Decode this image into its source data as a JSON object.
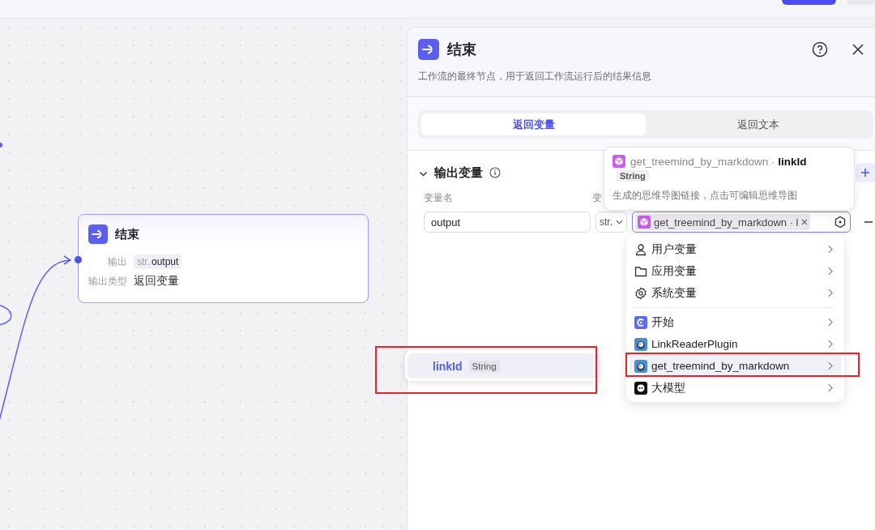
{
  "canvas": {
    "node": {
      "title": "结束",
      "rows": [
        {
          "kind": "tag",
          "label": "输出",
          "type_tag": "str.",
          "value": "output"
        },
        {
          "kind": "text",
          "label": "输出类型",
          "value": "返回变量"
        }
      ]
    }
  },
  "panel": {
    "title": "结束",
    "description": "工作流的最终节点，用于返回工作流运行后的结果信息",
    "tabs": [
      {
        "label": "返回变量",
        "selected": true
      },
      {
        "label": "返回文本",
        "selected": false
      }
    ],
    "section": {
      "title": "输出变量",
      "expanded": true,
      "columns": [
        {
          "label": "变量名"
        },
        {
          "label": "变"
        }
      ],
      "rows": [
        {
          "name": "output",
          "type": "str.",
          "reference": "get_treemind_by_markdown · l"
        }
      ]
    }
  },
  "tooltip": {
    "source": "get_treemind_by_markdown · ",
    "field": "linkId",
    "type": "String",
    "description": "生成的思维导图链接，点击可编辑思维导图"
  },
  "menu": {
    "groups": [
      [
        {
          "kind": "user",
          "label": "用户变量",
          "selected": false
        },
        {
          "kind": "folder",
          "label": "应用变量",
          "selected": false
        },
        {
          "kind": "system",
          "label": "系统变量",
          "selected": false
        }
      ],
      [
        {
          "kind": "start",
          "label": "开始",
          "selected": false
        },
        {
          "kind": "plugin",
          "label": "LinkReaderPlugin",
          "selected": false
        },
        {
          "kind": "plugin",
          "label": "get_treemind_by_markdown",
          "selected": true
        },
        {
          "kind": "model",
          "label": "大模型",
          "selected": false
        }
      ]
    ]
  },
  "submenu": {
    "items": [
      {
        "label": "linkId",
        "type": "String",
        "selected": true
      }
    ]
  }
}
